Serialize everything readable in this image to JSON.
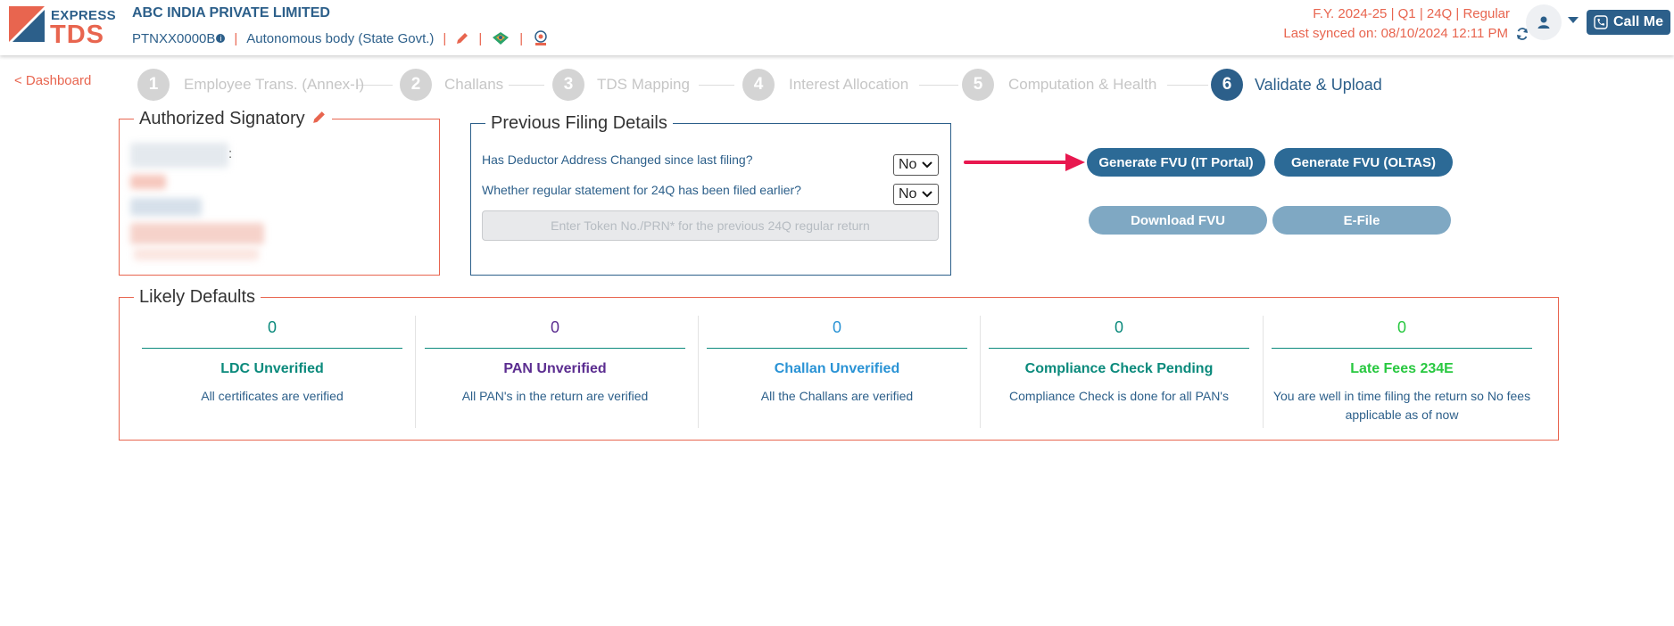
{
  "colors": {
    "brand_blue": "#2c5f8a",
    "brand_orange": "#e8654f",
    "ldc": "#0b8a7c",
    "pan": "#5b2d90",
    "challan": "#2a93d5",
    "compliance": "#0b8a7c",
    "late_fees": "#28c840"
  },
  "header": {
    "logo_top": "EXPRESS",
    "logo_bottom": "TDS",
    "company": "ABC INDIA PRIVATE LIMITED",
    "tan": "PTNXX0000B",
    "tan_info_icon": "info-icon",
    "deductor_type": "Autonomous body (State Govt.)",
    "fy_line": "F.Y. 2024-25  | Q1  | 24Q | Regular",
    "synced": "Last synced on: 08/10/2024 12:11 PM",
    "call_me": "Call Me"
  },
  "nav": {
    "dashboard": "< Dashboard",
    "steps": [
      {
        "num": "1",
        "label": "Employee Trans. (Annex-I)"
      },
      {
        "num": "2",
        "label": "Challans"
      },
      {
        "num": "3",
        "label": "TDS Mapping"
      },
      {
        "num": "4",
        "label": "Interest Allocation"
      },
      {
        "num": "5",
        "label": "Computation & Health"
      },
      {
        "num": "6",
        "label": "Validate & Upload"
      }
    ]
  },
  "authorized_signatory": {
    "title": "Authorized Signatory",
    "colon": ":"
  },
  "previous_filing": {
    "title": "Previous Filing Details",
    "q1": "Has Deductor Address Changed since last filing?",
    "q1_value": "No",
    "q2": "Whether regular statement for 24Q has been filed earlier?",
    "q2_value": "No",
    "token_placeholder": "Enter Token No./PRN* for the previous 24Q regular return"
  },
  "actions": {
    "generate_it": "Generate FVU (IT Portal)",
    "generate_oltas": "Generate FVU (OLTAS)",
    "download": "Download FVU",
    "efile": "E-File"
  },
  "likely_defaults": {
    "title": "Likely Defaults",
    "items": [
      {
        "count": "0",
        "title": "LDC Unverified",
        "desc": "All certificates are verified"
      },
      {
        "count": "0",
        "title": "PAN Unverified",
        "desc": "All PAN's in the return are verified"
      },
      {
        "count": "0",
        "title": "Challan Unverified",
        "desc": "All the Challans are verified"
      },
      {
        "count": "0",
        "title": "Compliance Check Pending",
        "desc": "Compliance Check is done for all PAN's"
      },
      {
        "count": "0",
        "title": "Late Fees 234E",
        "desc": "You are well in time filing the return so No fees applicable as of now"
      }
    ]
  }
}
